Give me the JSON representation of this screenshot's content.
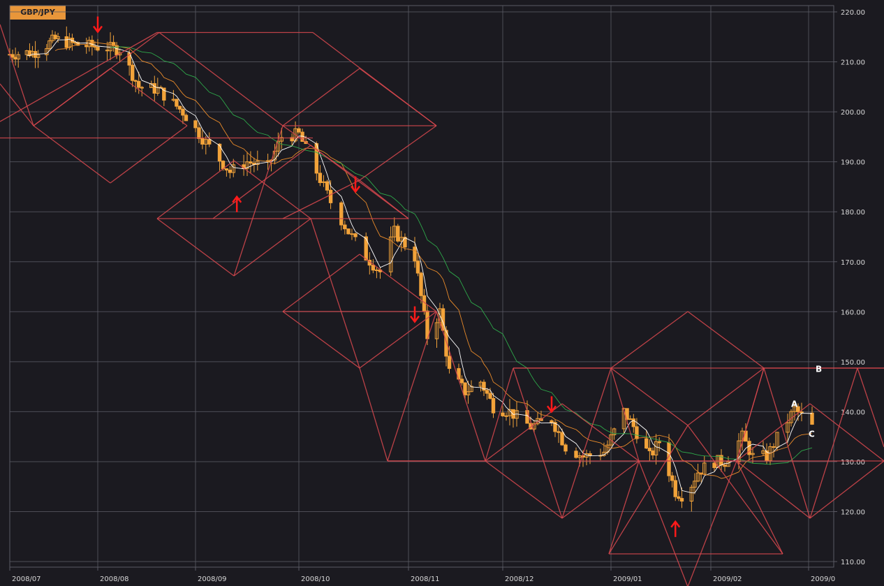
{
  "symbol": "GBP/JPY",
  "chart_data": {
    "type": "candlestick",
    "title": "GBP/JPY",
    "ylim": [
      108,
      222
    ],
    "y_ticks": [
      "220.00",
      "210.00",
      "200.00",
      "190.00",
      "180.00",
      "170.00",
      "160.00",
      "150.00",
      "140.00",
      "130.00",
      "120.00",
      "110.00"
    ],
    "x_ticks": [
      "2008/07",
      "2008/08",
      "2008/09",
      "2008/10",
      "2008/11",
      "2008/12",
      "2009/01",
      "2009/02",
      "2009/0"
    ],
    "colors": {
      "background": "#1b1a20",
      "candle": "#f2a33a",
      "grid": "#5a5a64",
      "geometry": "#d9484e",
      "arrow": "#ff1a1a",
      "ma_fast": "#ffffff",
      "ma_mid": "#e88a2a",
      "ma_slow": "#2ea84a"
    },
    "annotations": [
      {
        "label": "A",
        "date": "2009/02/24",
        "value": 141.5
      },
      {
        "label": "B",
        "date": "2009/03/03",
        "value": 148.5
      },
      {
        "label": "C",
        "date": "2009/03/01",
        "value": 135.5
      }
    ],
    "arrows": [
      {
        "dir": "down",
        "date": "2008/08/01",
        "value": 216
      },
      {
        "dir": "up",
        "date": "2008/09/13",
        "value": 183
      },
      {
        "dir": "down",
        "date": "2008/10/17",
        "value": 184
      },
      {
        "dir": "down",
        "date": "2008/11/03",
        "value": 158
      },
      {
        "dir": "down",
        "date": "2008/12/15",
        "value": 140
      },
      {
        "dir": "up",
        "date": "2009/01/21",
        "value": 118
      }
    ],
    "geometry_lines": [
      [
        0,
        197.5,
        448,
        197.5
      ],
      [
        0,
        174,
        225,
        46.5
      ],
      [
        225,
        46.5,
        448,
        46.5
      ],
      [
        448,
        46.5,
        625,
        180
      ],
      [
        225,
        313,
        585,
        313
      ],
      [
        405,
        180,
        625,
        180
      ],
      [
        555,
        660,
        1266,
        660
      ],
      [
        405,
        446,
        625,
        446
      ],
      [
        735,
        527,
        1266,
        527
      ],
      [
        872,
        793,
        1121,
        793
      ],
      [
        625,
        180,
        515,
        98
      ],
      [
        515,
        98,
        405,
        180
      ],
      [
        405,
        180,
        228,
        46.5
      ],
      [
        228,
        46.5,
        48,
        180
      ],
      [
        48,
        180,
        158,
        262
      ],
      [
        158,
        262,
        268,
        180
      ],
      [
        268,
        180,
        158,
        98
      ],
      [
        158,
        98,
        48,
        180
      ],
      [
        405,
        180,
        335,
        395
      ],
      [
        335,
        395,
        225,
        313
      ],
      [
        225,
        313,
        335,
        230
      ],
      [
        335,
        230,
        445,
        313
      ],
      [
        445,
        313,
        335,
        395
      ],
      [
        445,
        313,
        515,
        527
      ],
      [
        515,
        527,
        625,
        446
      ],
      [
        625,
        446,
        515,
        364
      ],
      [
        515,
        364,
        405,
        446
      ],
      [
        405,
        446,
        515,
        527
      ],
      [
        515,
        527,
        555,
        660
      ],
      [
        555,
        660,
        695,
        660
      ],
      [
        695,
        660,
        735,
        527
      ],
      [
        735,
        527,
        875,
        527
      ],
      [
        875,
        527,
        915,
        660
      ],
      [
        915,
        660,
        1055,
        660
      ],
      [
        1055,
        660,
        1094,
        527
      ],
      [
        1094,
        527,
        1266,
        527
      ],
      [
        695,
        660,
        805,
        742
      ],
      [
        805,
        742,
        915,
        660
      ],
      [
        915,
        660,
        805,
        578
      ],
      [
        805,
        578,
        695,
        660
      ],
      [
        875,
        527,
        985,
        446
      ],
      [
        985,
        446,
        1094,
        527
      ],
      [
        1094,
        527,
        985,
        609
      ],
      [
        985,
        609,
        875,
        527
      ],
      [
        915,
        660,
        872,
        793
      ],
      [
        1055,
        660,
        1121,
        793
      ],
      [
        1055,
        660,
        1160,
        742
      ],
      [
        1160,
        742,
        1266,
        660
      ],
      [
        1266,
        660,
        1160,
        578
      ],
      [
        1160,
        578,
        1055,
        660
      ],
      [
        1094,
        527,
        1160,
        742
      ],
      [
        1160,
        742,
        1228,
        527
      ],
      [
        1228,
        527,
        1266,
        640
      ],
      [
        585,
        313,
        445,
        208
      ],
      [
        445,
        208,
        305,
        313
      ],
      [
        0,
        35,
        48,
        180
      ],
      [
        0,
        120,
        48,
        180
      ],
      [
        625,
        446,
        695,
        660
      ],
      [
        625,
        446,
        555,
        660
      ],
      [
        735,
        527,
        805,
        742
      ],
      [
        875,
        527,
        805,
        742
      ],
      [
        1094,
        527,
        1055,
        660
      ],
      [
        915,
        660,
        985,
        840
      ],
      [
        1055,
        660,
        985,
        840
      ],
      [
        872,
        793,
        985,
        609
      ],
      [
        1121,
        793,
        985,
        609
      ],
      [
        405,
        180,
        515,
        258
      ],
      [
        625,
        180,
        515,
        258
      ],
      [
        515,
        258,
        405,
        313
      ],
      [
        515,
        258,
        585,
        313
      ]
    ]
  }
}
